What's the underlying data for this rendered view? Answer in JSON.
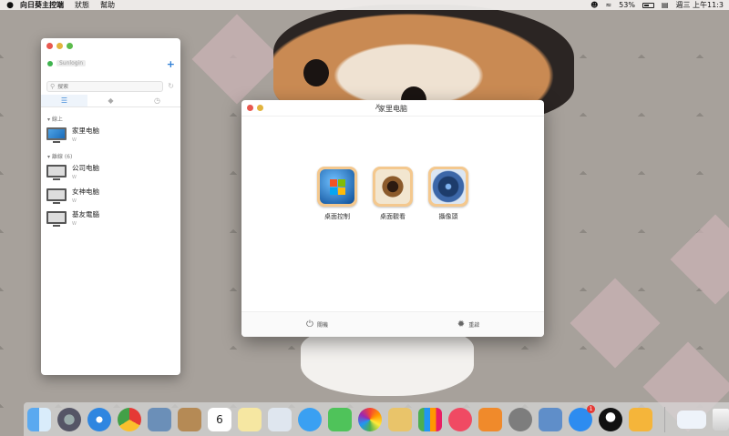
{
  "menubar": {
    "apple": "",
    "items": [
      "向日葵主控端",
      "狀態",
      "幫助"
    ],
    "battery_percent": "53%",
    "clock": "週三 上午11:3"
  },
  "sidebar": {
    "account_name": "Sunlogin",
    "search_placeholder": "搜索",
    "tabs": [
      "☰",
      "◆",
      "◷"
    ],
    "online_header": "▾ 線上",
    "offline_header": "▾ 離線 (6)",
    "online_devices": [
      {
        "name": "家里电脑",
        "sub": "W"
      }
    ],
    "offline_devices": [
      {
        "name": "公司电脑",
        "sub": "W"
      },
      {
        "name": "女神电脑",
        "sub": "W"
      },
      {
        "name": "基友電腦",
        "sub": "W"
      }
    ]
  },
  "main_window": {
    "title": "家里电脑",
    "apps": [
      {
        "label": "桌面控制",
        "icon": "windows-desktop-icon"
      },
      {
        "label": "桌面觀看",
        "icon": "eye-icon"
      },
      {
        "label": "攝像頭",
        "icon": "camera-icon"
      }
    ],
    "footer": {
      "shutdown_label": "關機",
      "restart_label": "重啟"
    }
  },
  "dock": {
    "calendar_day": "6",
    "appstore_badge": "1"
  },
  "colors": {
    "accent": "#2f7fd6",
    "online": "#3fb34f",
    "icon_frame": "#f4c88e"
  }
}
